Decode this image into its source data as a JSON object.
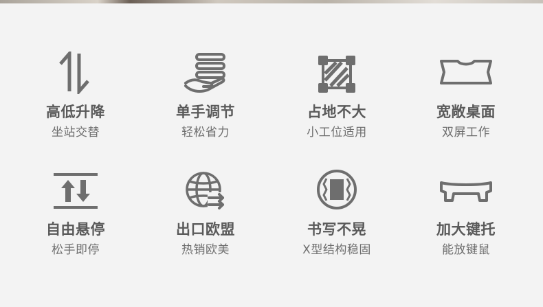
{
  "features": [
    {
      "title": "高低升降",
      "subtitle": "坐站交替",
      "icon": "up-down-arrows-icon"
    },
    {
      "title": "单手调节",
      "subtitle": "轻松省力",
      "icon": "hand-icon"
    },
    {
      "title": "占地不大",
      "subtitle": "小工位适用",
      "icon": "compact-area-icon"
    },
    {
      "title": "宽敞桌面",
      "subtitle": "双屏工作",
      "icon": "desktop-surface-icon"
    },
    {
      "title": "自由悬停",
      "subtitle": "松手即停",
      "icon": "hover-stop-icon"
    },
    {
      "title": "出口欧盟",
      "subtitle": "热销欧美",
      "icon": "globe-export-icon"
    },
    {
      "title": "书写不晃",
      "subtitle": "X型结构稳固",
      "icon": "stable-structure-icon"
    },
    {
      "title": "加大键托",
      "subtitle": "能放键鼠",
      "icon": "keyboard-tray-icon"
    }
  ],
  "colors": {
    "icon": "#6e6e6e",
    "background": "#f3f3f3"
  }
}
